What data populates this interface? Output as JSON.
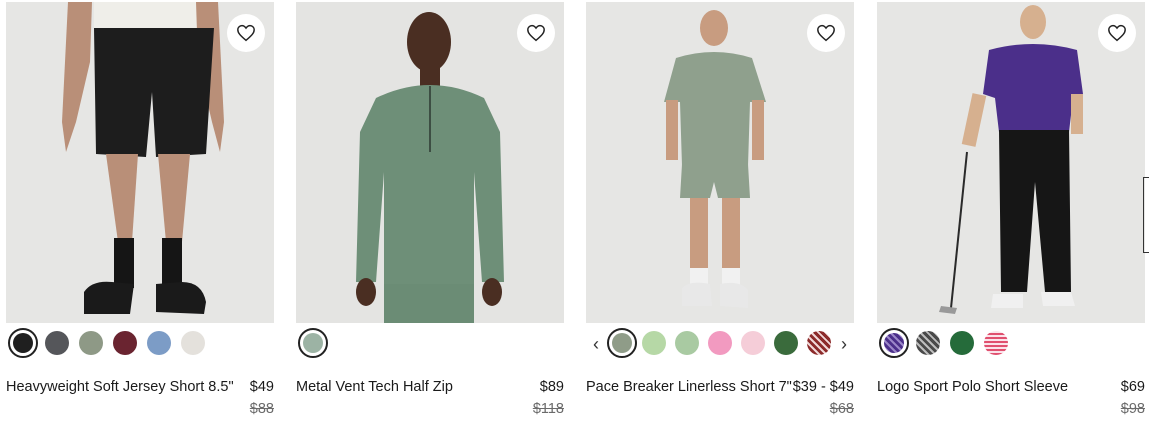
{
  "products": [
    {
      "name": "Heavyweight Soft Jersey Short 8.5\"",
      "price": "$49",
      "original_price": "$88",
      "wishlist_icon": "heart-outline-icon",
      "swatch_colors": [
        "#1f1f1f",
        "#55565a",
        "#8e9986",
        "#6a2430",
        "#7c9cc6",
        "#e4e1dc"
      ]
    },
    {
      "name": "Metal Vent Tech Half Zip",
      "price": "$89",
      "original_price": "$118",
      "wishlist_icon": "heart-outline-icon",
      "swatch_colors": [
        "#9cb3a4"
      ]
    },
    {
      "name": "Pace Breaker Linerless Short 7\"",
      "price": "$39 - $49",
      "original_price": "$68",
      "wishlist_icon": "heart-outline-icon",
      "prev_icon": "chevron-left-icon",
      "next_icon": "chevron-right-icon",
      "swatch_colors": [
        "#8f9c88",
        "#b6d8a6",
        "#a9caa2",
        "#f29ac0",
        "#f5cdd8",
        "#3a6b3c",
        "#8c2b2b"
      ]
    },
    {
      "name": "Logo Sport Polo Short Sleeve",
      "price": "$69",
      "original_price": "$98",
      "wishlist_icon": "heart-outline-icon",
      "swatch_colors": [
        "#4b2f8a",
        "#4a4a4a",
        "#256b3a",
        "#e0506f"
      ]
    }
  ]
}
